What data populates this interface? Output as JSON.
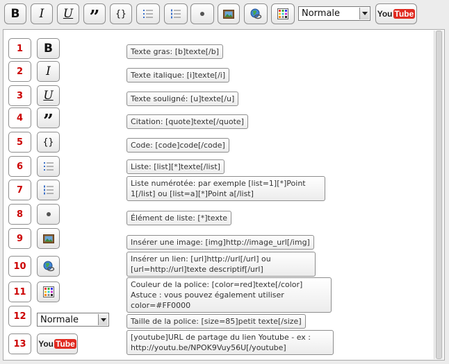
{
  "toolbar": {
    "bold_glyph": "B",
    "italic_glyph": "I",
    "underline_glyph": "U",
    "quote_glyph": "”",
    "code_glyph": "{}",
    "font_size_select": {
      "selected": "Normale"
    },
    "youtube": {
      "you": "You",
      "tube": "Tube"
    }
  },
  "help_rows": [
    {
      "number": "1",
      "tool": "bold",
      "description": "Texte gras: [b]texte[/b]"
    },
    {
      "number": "2",
      "tool": "italic",
      "description": "Texte italique: [i]texte[/i]"
    },
    {
      "number": "3",
      "tool": "underline",
      "description": "Texte souligné: [u]texte[/u]"
    },
    {
      "number": "4",
      "tool": "quote",
      "description": "Citation: [quote]texte[/quote]"
    },
    {
      "number": "5",
      "tool": "code",
      "description": "Code: [code]code[/code]"
    },
    {
      "number": "6",
      "tool": "list",
      "description": "Liste: [list][*]texte[/list]"
    },
    {
      "number": "7",
      "tool": "numbered-list",
      "description": "Liste numérotée: par exemple [list=1][*]Point 1[/list] ou [list=a][*]Point a[/list]"
    },
    {
      "number": "8",
      "tool": "list-item",
      "description": "Élément de liste: [*]texte"
    },
    {
      "number": "9",
      "tool": "image",
      "description": "Insérer une image: [img]http://image_url[/img]"
    },
    {
      "number": "10",
      "tool": "link",
      "description": "Insérer un lien: [url]http://url[/url] ou [url=http://url]texte descriptif[/url]"
    },
    {
      "number": "11",
      "tool": "color",
      "description": "Couleur de la police: [color=red]texte[/color] Astuce : vous pouvez également utiliser color=#FF0000"
    },
    {
      "number": "12",
      "tool": "font-size",
      "description": "Taille de la police: [size=85]petit texte[/size]"
    },
    {
      "number": "13",
      "tool": "youtube",
      "description": "[youtube]URL de partage du lien Youtube - ex : http://youtu.be/NPOK9Vuy56U[/youtube]"
    }
  ],
  "colors": {
    "row_number": "#cc0000",
    "youtube_red": "#e02a20",
    "panel_background": "#ffffff",
    "page_background": "#ececec"
  }
}
